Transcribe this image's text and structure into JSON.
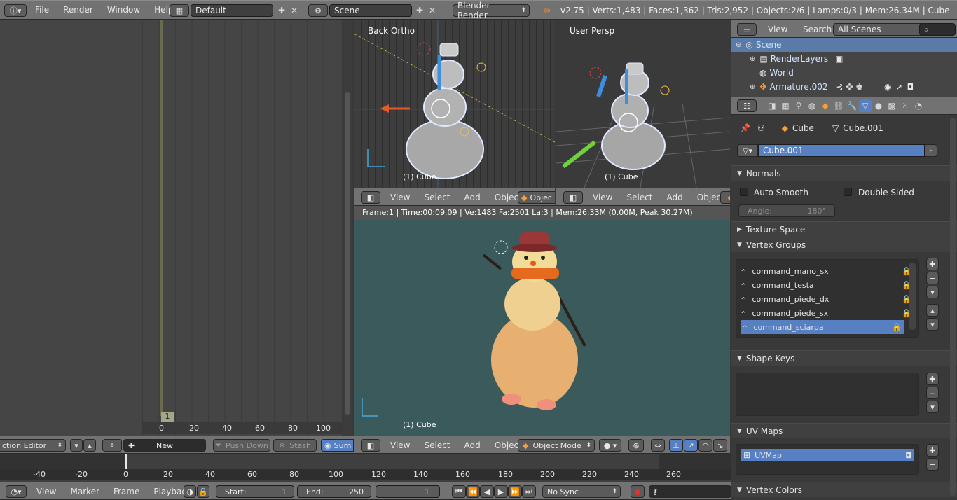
{
  "topbar": {
    "menus": [
      "File",
      "Render",
      "Window",
      "Help"
    ],
    "layout": "Default",
    "scene": "Scene",
    "engine": "Blender Render",
    "stats": "v2.75 | Verts:1,483 | Faces:1,362 | Tris:2,952 | Objects:2/6 | Lamps:0/3 | Mem:26.34M | Cube"
  },
  "action_editor": {
    "frame_marker": "1",
    "ruler": [
      "0",
      "20",
      "40",
      "60",
      "80",
      "100"
    ],
    "header": {
      "editor": "ction Editor",
      "new": "New",
      "push_down": "Push Down",
      "stash": "Stash",
      "summary": "Sum"
    }
  },
  "vp_back": {
    "label": "Back Ortho",
    "object": "(1) Cube",
    "menus": [
      "View",
      "Select",
      "Add",
      "Object"
    ],
    "mode": "Objec"
  },
  "vp_persp": {
    "label": "User Persp",
    "object": "(1) Cube",
    "menus": [
      "View",
      "Select",
      "Add",
      "Object"
    ]
  },
  "vp_render": {
    "info": "Frame:1 | Time:00:09.09 | Ve:1483 Fa:2501 La:3 | Mem:26.33M (0.00M, Peak 30.27M)",
    "object": "(1) Cube",
    "menus": [
      "View",
      "Select",
      "Add",
      "Object"
    ],
    "mode": "Object Mode"
  },
  "outliner": {
    "menus": [
      "View",
      "Search"
    ],
    "filter": "All Scenes",
    "items": [
      "Scene",
      "RenderLayers",
      "World",
      "Armature.002"
    ]
  },
  "properties": {
    "breadcrumb": [
      "Cube",
      "Cube.001"
    ],
    "mesh_name": "Cube.001",
    "fake": "F",
    "normals": {
      "title": "Normals",
      "auto_smooth": "Auto Smooth",
      "double_sided": "Double Sided",
      "angle_label": "Angle:",
      "angle_value": "180°"
    },
    "texture_space": "Texture Space",
    "vertex_groups": {
      "title": "Vertex Groups",
      "items": [
        "command_mano_sx",
        "command_testa",
        "command_piede_dx",
        "command_piede_sx",
        "command_sciarpa"
      ]
    },
    "shape_keys": "Shape Keys",
    "uv_maps": {
      "title": "UV Maps",
      "items": [
        "UVMap"
      ]
    },
    "vertex_colors": "Vertex Colors"
  },
  "timeline": {
    "ticks": [
      "-40",
      "-20",
      "0",
      "20",
      "40",
      "60",
      "80",
      "100",
      "120",
      "140",
      "160",
      "180",
      "200",
      "220",
      "240",
      "260"
    ],
    "menus": [
      "View",
      "Marker",
      "Frame",
      "Playback"
    ],
    "start_label": "Start:",
    "start": "1",
    "end_label": "End:",
    "end": "250",
    "current": "1",
    "sync": "No Sync"
  }
}
